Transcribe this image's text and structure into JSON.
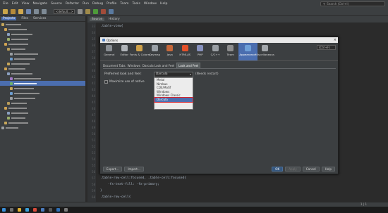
{
  "menubar": {
    "items": [
      "File",
      "Edit",
      "View",
      "Navigate",
      "Source",
      "Refactor",
      "Run",
      "Debug",
      "Profile",
      "Team",
      "Tools",
      "Window",
      "Help"
    ],
    "search_placeholder": "Search (Ctrl+I)"
  },
  "toolbar": {
    "config_combo": "<default...>"
  },
  "project_panel": {
    "tabs": [
      "Projects",
      "Files",
      "Services"
    ]
  },
  "editor": {
    "tabs": [
      "Source",
      "History"
    ],
    "lines": [
      {
        "no": "33",
        "text": ".table-view{",
        "style": "plain"
      },
      {
        "no": "34",
        "text": "",
        "style": "plain"
      },
      {
        "no": "35",
        "text": "",
        "style": "plain"
      },
      {
        "no": "36",
        "text": "",
        "style": "plain"
      },
      {
        "no": "37",
        "text": "",
        "style": "plain"
      },
      {
        "no": "38",
        "text": "",
        "style": "plain"
      },
      {
        "no": "39",
        "text": "",
        "style": "plain"
      },
      {
        "no": "40",
        "text": "",
        "style": "plain"
      },
      {
        "no": "41",
        "text": "",
        "style": "plain"
      },
      {
        "no": "42",
        "text": "",
        "style": "plain"
      },
      {
        "no": "43",
        "text": "",
        "style": "plain"
      },
      {
        "no": "44",
        "text": "",
        "style": "plain"
      },
      {
        "no": "45",
        "text": "",
        "style": "plain"
      },
      {
        "no": "46",
        "text": "",
        "style": "plain"
      },
      {
        "no": "47",
        "text": "",
        "style": "plain"
      },
      {
        "no": "48",
        "text": "",
        "style": "plain"
      },
      {
        "no": "49",
        "text": "",
        "style": "plain"
      },
      {
        "no": "50",
        "text": "",
        "style": "plain"
      },
      {
        "no": "51",
        "text": "",
        "style": "plain"
      },
      {
        "no": "52",
        "text": "",
        "style": "plain"
      },
      {
        "no": "53",
        "text": "",
        "style": "plain"
      },
      {
        "no": "54",
        "text": "",
        "style": "plain"
      },
      {
        "no": "55",
        "text": "}",
        "style": "plain"
      },
      {
        "no": "56",
        "text": "",
        "style": "plain"
      },
      {
        "no": "57",
        "text": ".table-row-cell:focused, .table-cell:focused{",
        "style": "plain"
      },
      {
        "no": "58",
        "text": "    -fx-text-fill: -fx-primary;",
        "style": "plain"
      },
      {
        "no": "59",
        "text": "}",
        "style": "plain"
      },
      {
        "no": "60",
        "text": ".table-row-cell{",
        "style": "plain"
      }
    ]
  },
  "dialog": {
    "title": "Options",
    "categories": [
      {
        "label": "General",
        "icon": "general-icon",
        "color": "#8a8f94"
      },
      {
        "label": "Editor",
        "icon": "editor-icon",
        "color": "#b0b4b8"
      },
      {
        "label": "Fonts & Colors",
        "icon": "fonts-colors-icon",
        "color": "#d0a24a"
      },
      {
        "label": "Keymap",
        "icon": "keymap-icon",
        "color": "#9aa0a6"
      },
      {
        "label": "Java",
        "icon": "java-icon",
        "color": "#c7683a"
      },
      {
        "label": "HTML/JS",
        "icon": "html5-icon",
        "color": "#e3512a"
      },
      {
        "label": "PHP",
        "icon": "php-icon",
        "color": "#8892bf"
      },
      {
        "label": "C/C++",
        "icon": "cpp-icon",
        "color": "#9a9fa4"
      },
      {
        "label": "Team",
        "icon": "team-icon",
        "color": "#8e8e8e"
      },
      {
        "label": "Appearance",
        "icon": "appearance-icon",
        "color": "#6fa0d8"
      },
      {
        "label": "Miscellaneous",
        "icon": "miscellaneous-icon",
        "color": "#a3a7ab"
      }
    ],
    "selected_category": "Appearance",
    "filter_placeholder": "(Ctrl+F)",
    "subtabs": [
      "Document Tabs",
      "Windows",
      "Darcula Look and Feel",
      "Look and Feel"
    ],
    "active_subtab": "Look and Feel",
    "laf_label": "Preferred look and feel:",
    "laf_value": "Darcula",
    "restart_note": "(Needs restart)",
    "maximize_label": "Maximize use of native",
    "laf_options": [
      "Metal",
      "Nimbus",
      "CDE/Motif",
      "Windows",
      "Windows Classic",
      "Darcula"
    ],
    "selected_option": "Darcula",
    "buttons": {
      "export": "Export...",
      "import": "Import...",
      "ok": "OK",
      "apply": "Apply",
      "cancel": "Cancel",
      "help": "Help"
    }
  },
  "status": {
    "position": "1 | 1"
  }
}
